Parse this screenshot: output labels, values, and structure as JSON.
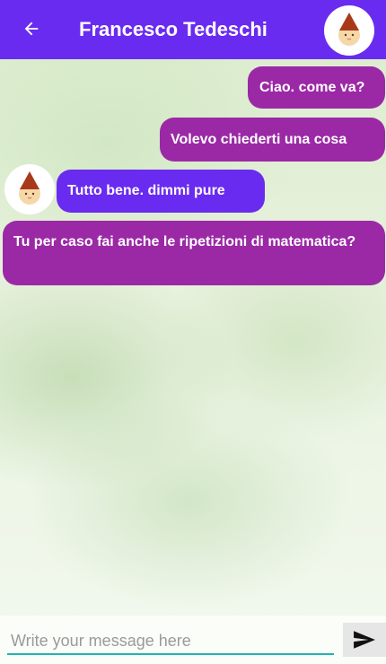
{
  "header": {
    "title": "Francesco Tedeschi",
    "back_icon": "arrow-left-icon",
    "avatar_icon": "gnome-avatar-icon",
    "background_color": "#6a2bf0"
  },
  "messages": [
    {
      "text": "Ciao. come va?",
      "direction": "sent"
    },
    {
      "text": "Volevo chiederti una cosa",
      "direction": "sent"
    },
    {
      "text": "Tutto bene. dimmi pure",
      "direction": "received"
    },
    {
      "text": "Tu per caso fai anche le ripetizioni di matematica?",
      "direction": "sent"
    }
  ],
  "composer": {
    "placeholder": "Write your message here",
    "value": "",
    "send_icon": "send-icon"
  },
  "colors": {
    "sent_bubble": "#9b29a6",
    "received_bubble": "#6a2bf0",
    "input_underline": "#1fb3b0"
  }
}
